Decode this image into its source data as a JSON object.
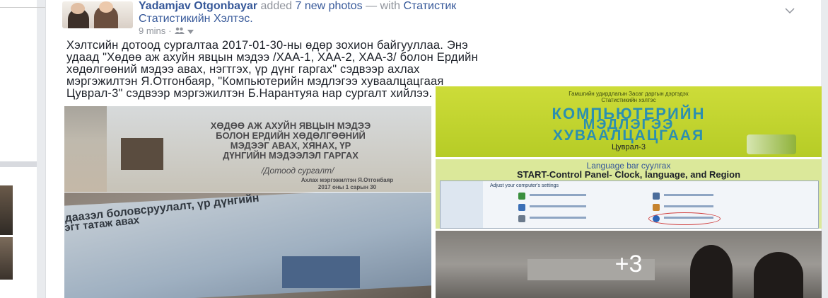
{
  "post": {
    "author": "Yadamjav Otgonbayar",
    "action": "added",
    "photo_count": "7 new photos",
    "with_text": "— with",
    "tagged_line1": "Статистик",
    "tagged_line2": "Статистикийн Хэлтэс.",
    "time": "9 mins",
    "privacy_icon": "friends-icon",
    "text_lines": [
      "Хэлтсийн дотоод сургалтаа 2017-01-30-ны өдөр зохион байгууллаа. Энэ",
      "удаад \"Хөдөө аж ахуйн явцын мэдээ /ХАА-1, ХАА-2, ХАА-3/ болон Ердийн",
      "хөдөлгөөний мэдээ авах, нэгтгэх, үр дүнг гаргах\" сэдвээр ахлах",
      "мэргэжилтэн Я.Отгонбаяр, \"Компьютерийн мэдлэгээ хуваалцацгаая",
      "Цуврал-3\" сэдвээр мэргэжилтэн Б.Нарантуяа нар сургалт хийлээ."
    ]
  },
  "photos": {
    "photo1": {
      "lines": [
        "ХӨДӨӨ АЖ АХУЙН ЯВЦЫН МЭДЭЭ",
        "БОЛОН ЕРДИЙН ХӨДӨЛГӨӨНИЙ",
        "МЭДЭЭГ АВАХ, ХЯНАХ, ҮР",
        "ДҮНГИЙН МЭДЭЭЛЭЛ ГАРГАХ"
      ],
      "subtitle": "/Дотоод сургалт/",
      "author": "Ахлах мэргэжилтэн Я.Отгонбаяр",
      "date": "2017 оны 1 сарын 30"
    },
    "photo2": {
      "line1": "даазэл боловсруулалт, үр дүнгийн",
      "line2": "эгт татаж авах"
    },
    "photo3": {
      "top_line1": "Гамшгийн удирдлагын Засаг даргын дэргэдэх",
      "top_line2": "Статистикийн хэлтэс",
      "title1": "КОМПЬЮТЕРИЙН",
      "title2": "МЭДЛЭГЭЭ",
      "title3": "ХУВААЛЦАЦГААЯ",
      "series": "Цуврал-3"
    },
    "photo4": {
      "heading": "Language bar суулгах",
      "path": "START-Control Panel- Clock, language, and Region",
      "window_title": "Adjust your computer's settings"
    },
    "photo5": {
      "more": "+3"
    }
  },
  "colors": {
    "link": "#365899",
    "meta": "#90949c",
    "text": "#1d2129"
  }
}
